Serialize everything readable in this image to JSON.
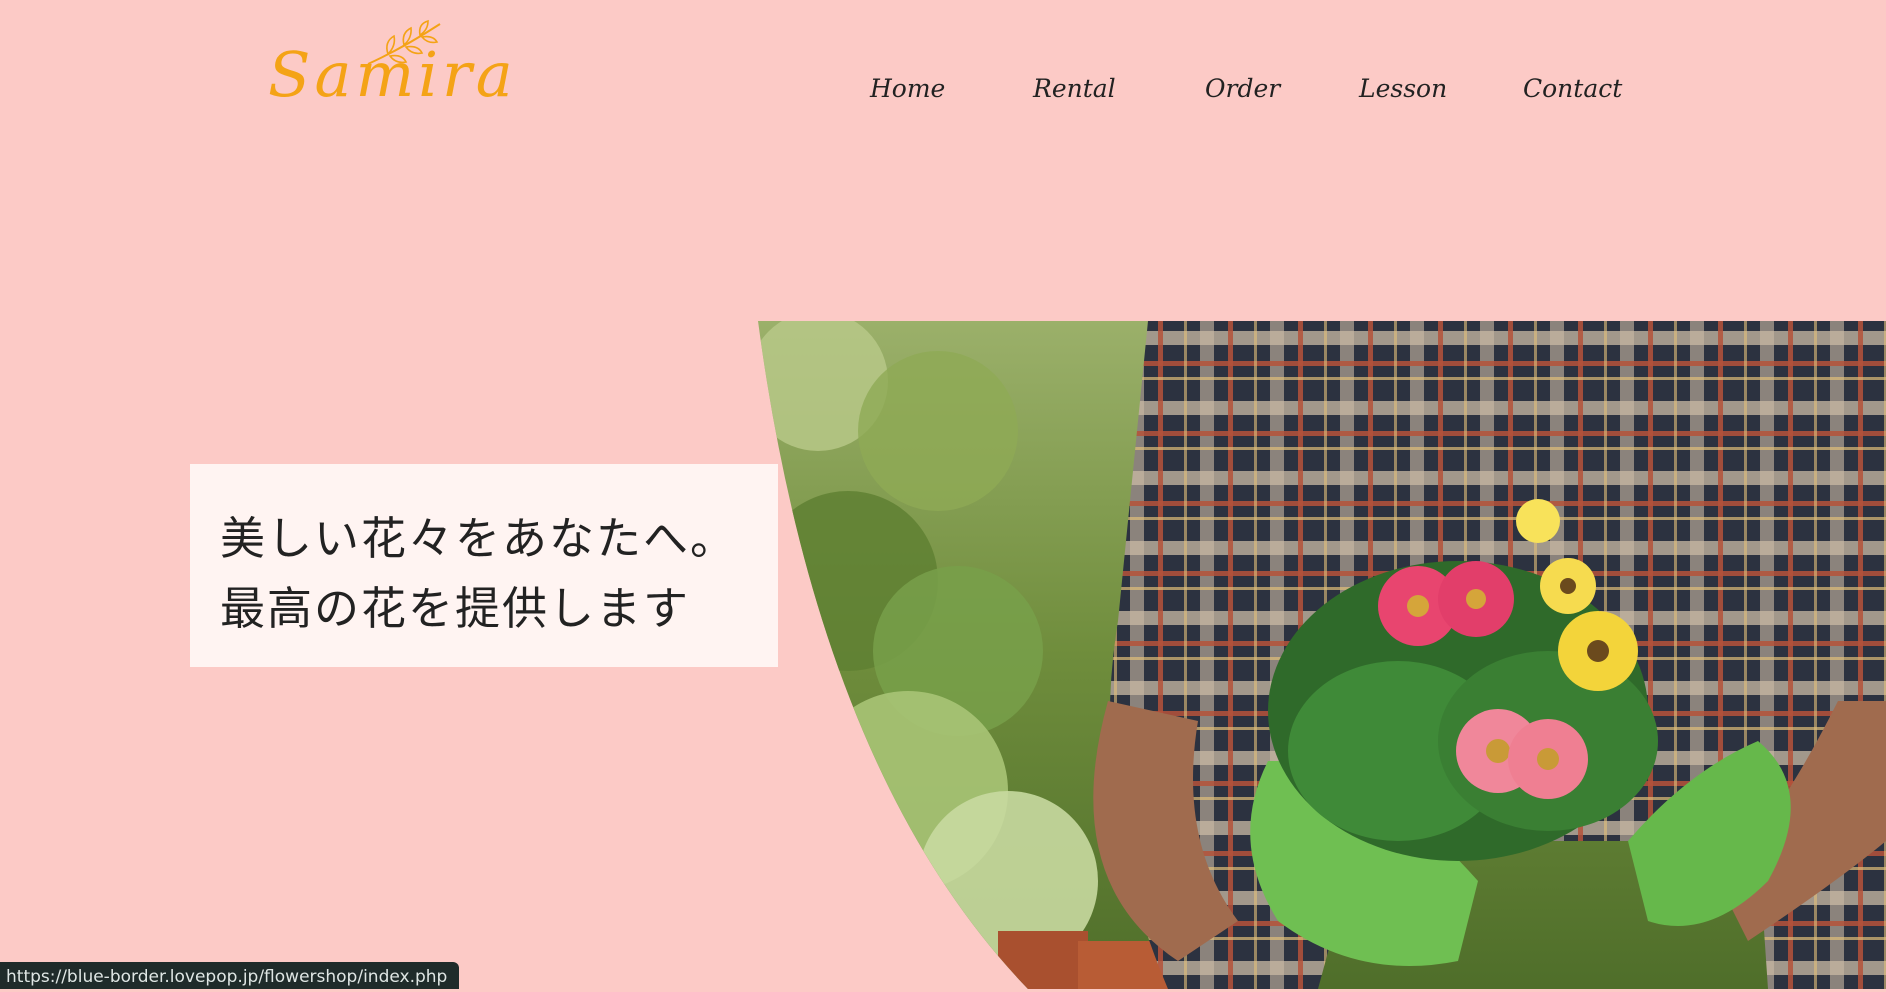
{
  "brand": {
    "name": "Samira",
    "color": "#f4a316"
  },
  "nav": {
    "items": [
      {
        "label": "Home"
      },
      {
        "label": "Rental"
      },
      {
        "label": "Order"
      },
      {
        "label": "Lesson"
      },
      {
        "label": "Contact"
      }
    ]
  },
  "hero": {
    "tagline_line1": "美しい花々をあなたへ。",
    "tagline_line2": "最高の花を提供します",
    "image": "gardener-holding-gerbera-flowers"
  },
  "status_bar": {
    "url": "https://blue-border.lovepop.jp/flowershop/index.php"
  },
  "colors": {
    "background": "#fccac6",
    "tagline_box": "#fff5f4",
    "text": "#222222"
  }
}
